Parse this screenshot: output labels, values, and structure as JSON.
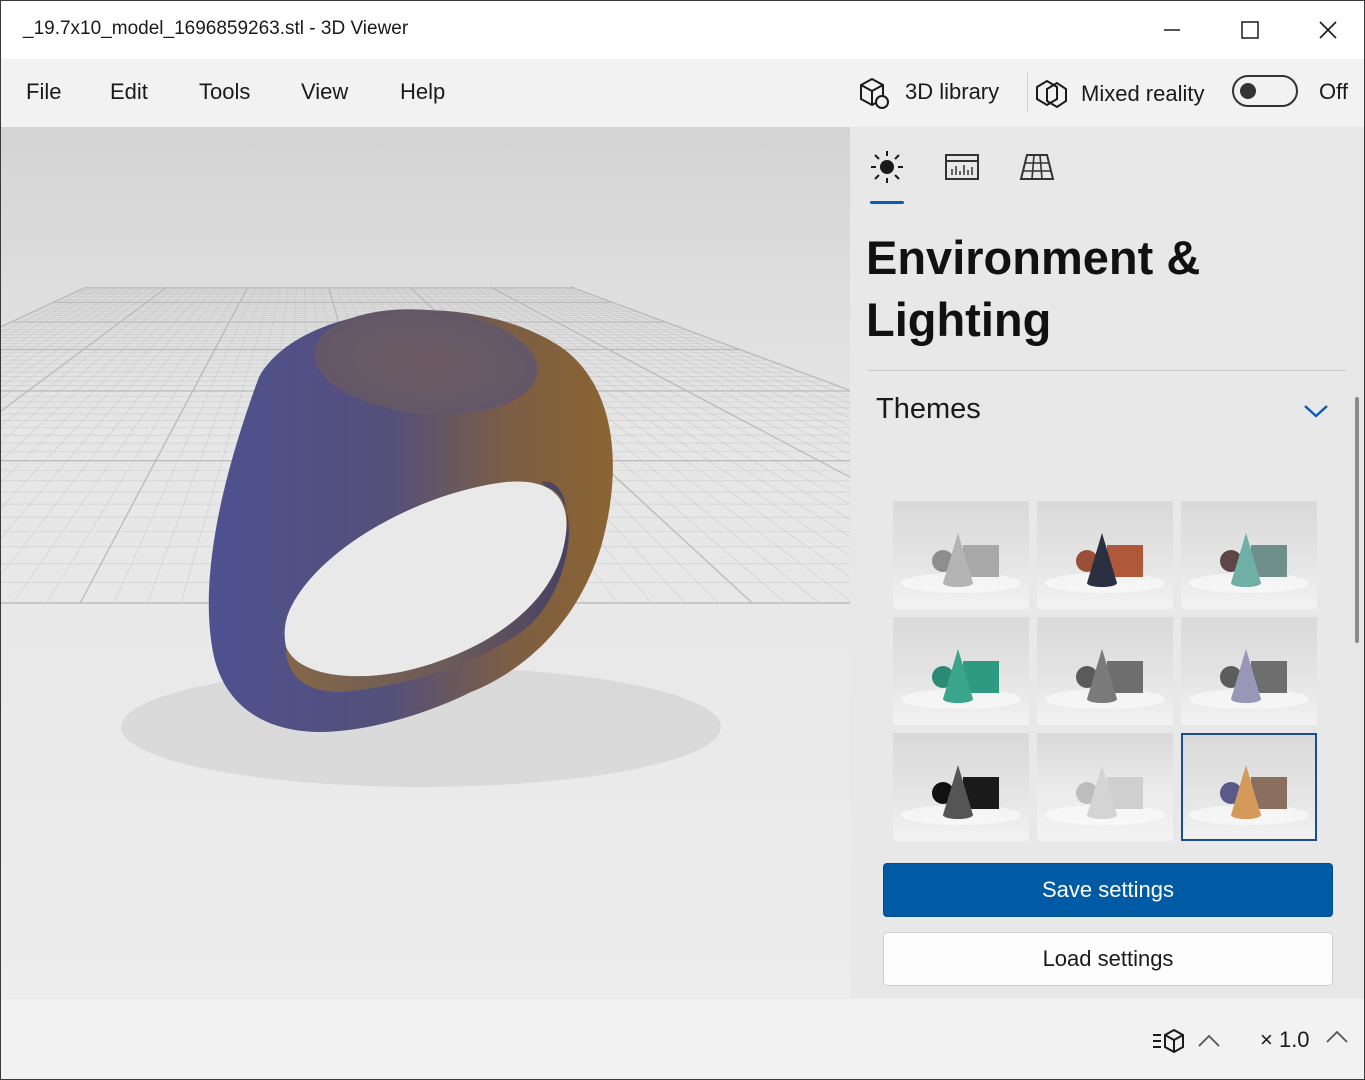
{
  "window": {
    "title": "_19.7x10_model_1696859263.stl - 3D Viewer",
    "controls": [
      "minimize-icon",
      "maximize-icon",
      "close-icon"
    ]
  },
  "menu": {
    "items": [
      {
        "label": "File"
      },
      {
        "label": "Edit"
      },
      {
        "label": "Tools"
      },
      {
        "label": "View"
      },
      {
        "label": "Help"
      }
    ],
    "library_label": "3D library",
    "mixed_reality_label": "Mixed reality",
    "toggle_state": "Off"
  },
  "panel": {
    "tabs": [
      {
        "icon": "sun-icon",
        "selected": true
      },
      {
        "icon": "stats-icon",
        "selected": false
      },
      {
        "icon": "grid-icon",
        "selected": false
      }
    ],
    "heading": "Environment & Lighting",
    "section_title": "Themes",
    "themes": [
      {
        "sphere": "#8e8e8e",
        "cone": "#b4b4b4",
        "box": "#a8a8a8",
        "bg": "#e4e4e4",
        "selected": false
      },
      {
        "sphere": "#9a5036",
        "cone": "#2b2f42",
        "box": "#b0593a",
        "bg": "#e4e4e4",
        "selected": false
      },
      {
        "sphere": "#5e4646",
        "cone": "#6fb0a6",
        "box": "#6f8f8a",
        "bg": "#e4e4e4",
        "selected": false
      },
      {
        "sphere": "#2a8a76",
        "cone": "#3aa58b",
        "box": "#2f9a82",
        "bg": "#e4e4e4",
        "selected": false
      },
      {
        "sphere": "#5a5a5a",
        "cone": "#7a7a7a",
        "box": "#6e6e6e",
        "bg": "#e4e4e4",
        "selected": false
      },
      {
        "sphere": "#5c5c5c",
        "cone": "#9a96b8",
        "box": "#6e6e6e",
        "bg": "#e4e4e4",
        "selected": false
      },
      {
        "sphere": "#111111",
        "cone": "#555555",
        "box": "#1a1a1a",
        "bg": "#e4e4e4",
        "selected": false
      },
      {
        "sphere": "#bdbdbd",
        "cone": "#d4d4d4",
        "box": "#cfcfcf",
        "bg": "#ececec",
        "selected": false
      },
      {
        "sphere": "#5a5a8a",
        "cone": "#d59a5a",
        "box": "#8a6e5e",
        "bg": "#e4e4e4",
        "selected": true
      }
    ],
    "save_label": "Save settings",
    "load_label": "Load settings"
  },
  "status": {
    "zoom": "× 1.0"
  },
  "colors": {
    "accent": "#005ba4",
    "ring_left": "#4d4f86",
    "ring_right": "#8a6438",
    "ring_top": "#6a5a66"
  }
}
